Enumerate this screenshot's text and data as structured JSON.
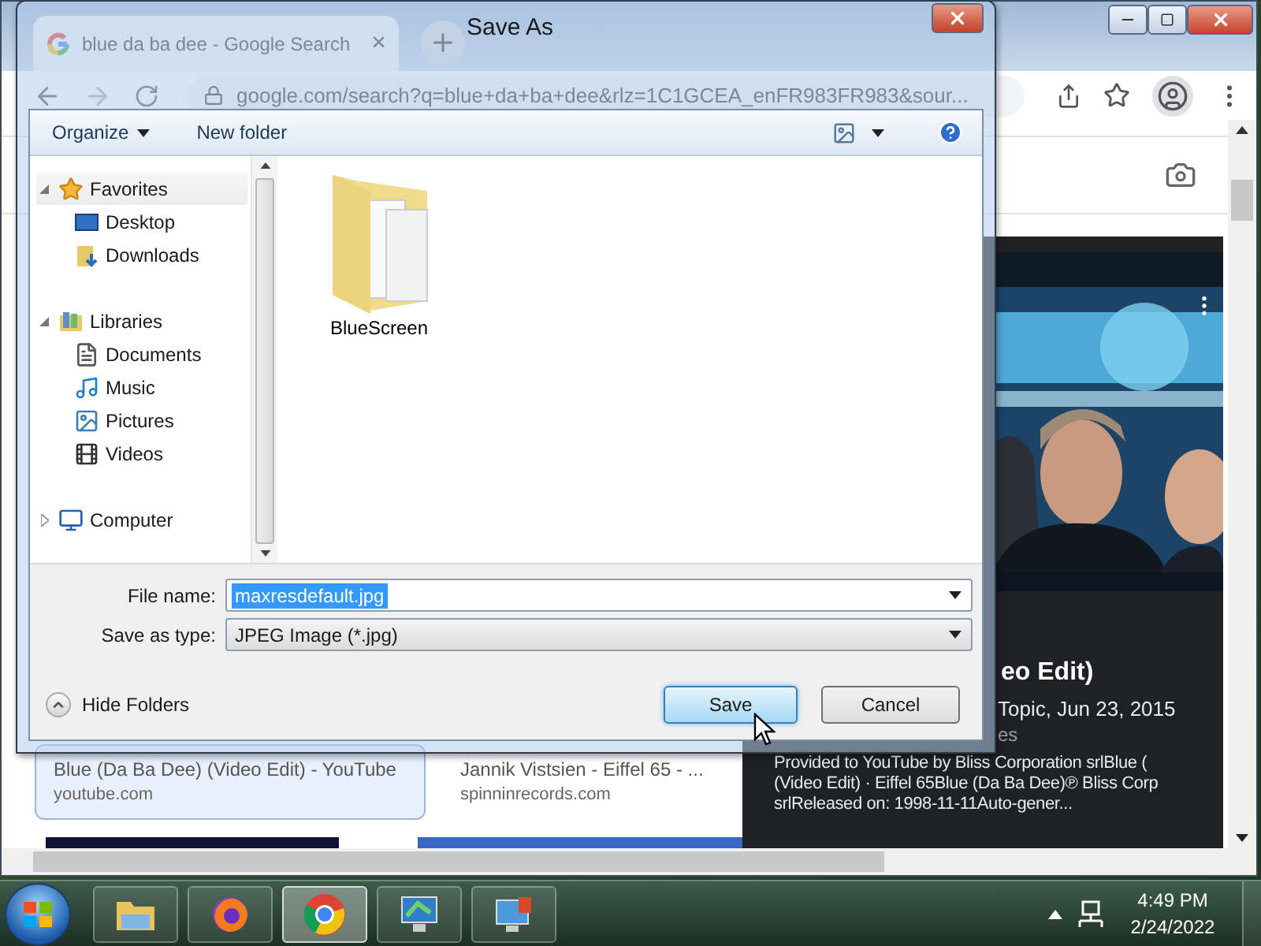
{
  "browser": {
    "tab": {
      "title": "blue da ba dee - Google Search",
      "close": "×"
    },
    "address": "google.com/search?q=blue+da+ba+dee&rlz=1C1GCEA_enFR983FR983&sour...",
    "result_cards": [
      {
        "title": "Blue (Da Ba Dee) (Video Edit) - YouTube",
        "site": "youtube.com",
        "selected": true
      },
      {
        "title": "Jannik Vistsien - Eiffel 65 - ...",
        "site": "spinninrecords.com",
        "selected": false
      }
    ],
    "panel": {
      "picture": {
        "kind": "picture"
      },
      "title": "eo Edit)",
      "meta": "Topic, Jun 23, 2015",
      "meta_2": "es",
      "description": [
        "Provided to YouTube by Bliss Corporation srlBlue (",
        "(Video Edit) · Eiffel 65Blue (Da Ba Dee)℗ Bliss Corp",
        "srlReleased on: 1998-11-11Auto-gener..."
      ]
    }
  },
  "dialog": {
    "title": "Save As",
    "toolbar": {
      "organize": "Organize",
      "new_folder": "New folder"
    },
    "nav": [
      {
        "label": "Favorites",
        "expanded": true,
        "selected": true,
        "children": [
          {
            "label": "Desktop",
            "selected": false
          },
          {
            "label": "Downloads",
            "selected": false
          }
        ]
      },
      {
        "label": "Libraries",
        "expanded": true,
        "selected": false,
        "children": [
          {
            "label": "Documents",
            "selected": false
          },
          {
            "label": "Music",
            "selected": false
          },
          {
            "label": "Pictures",
            "selected": false
          },
          {
            "label": "Videos",
            "selected": false
          }
        ]
      },
      {
        "label": "Computer",
        "expanded": false,
        "selected": false
      }
    ],
    "files": [
      {
        "name": "BlueScreen"
      }
    ],
    "file_name": {
      "label": "File name:",
      "value": "maxresdefault.jpg",
      "text_selected": true
    },
    "save_type": {
      "label": "Save as type:",
      "value": "JPEG Image (*.jpg)"
    },
    "hide_folders": "Hide Folders",
    "buttons": [
      {
        "label": "Save",
        "default": true
      },
      {
        "label": "Cancel",
        "default": false
      }
    ]
  },
  "taskbar": {
    "apps": [
      {
        "selected": false
      },
      {
        "selected": false
      },
      {
        "selected": true
      },
      {
        "selected": false
      },
      {
        "selected": false
      }
    ],
    "clock": {
      "time": "4:49 PM",
      "date": "2/24/2022"
    }
  }
}
